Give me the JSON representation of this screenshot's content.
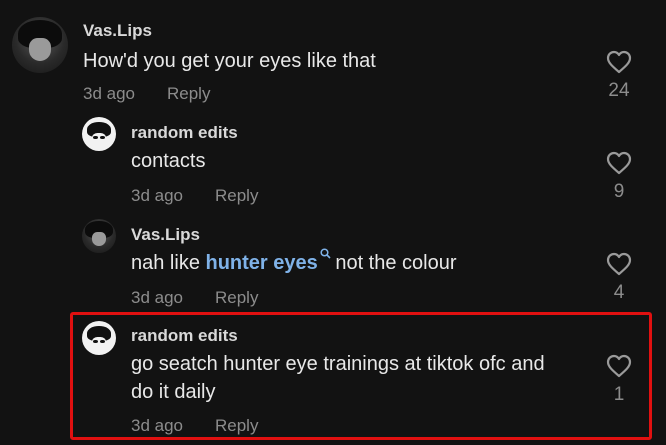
{
  "comments": [
    {
      "username": "Vas.Lips",
      "text": "How'd you get your eyes like that",
      "time": "3d ago",
      "reply_label": "Reply",
      "likes": "24"
    },
    {
      "username": "random edits",
      "text": "contacts",
      "time": "3d ago",
      "reply_label": "Reply",
      "likes": "9"
    },
    {
      "username": "Vas.Lips",
      "text_before": "nah like ",
      "link": "hunter eyes",
      "text_after": " not the colour",
      "time": "3d ago",
      "reply_label": "Reply",
      "likes": "4"
    },
    {
      "username": "random edits",
      "text_line1": "go seatch hunter eye trainings at tiktok ofc and",
      "text_line2": "do it daily",
      "time": "3d ago",
      "reply_label": "Reply",
      "likes": "1"
    }
  ],
  "colors": {
    "background": "#121212",
    "link": "#7fb2e8",
    "highlight": "#e01010",
    "muted": "#8c8c8c"
  }
}
